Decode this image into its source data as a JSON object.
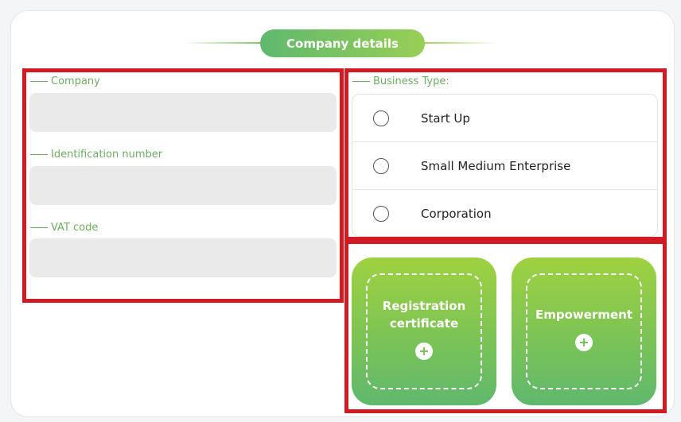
{
  "header": {
    "title": "Company details"
  },
  "form": {
    "fields": [
      {
        "label": "Company",
        "value": ""
      },
      {
        "label": "Identification number",
        "value": ""
      },
      {
        "label": "VAT code",
        "value": ""
      }
    ]
  },
  "business_type": {
    "legend": "Business Type:",
    "options": [
      {
        "label": "Start Up",
        "selected": false
      },
      {
        "label": "Small Medium Enterprise",
        "selected": false
      },
      {
        "label": "Corporation",
        "selected": false
      }
    ]
  },
  "uploads": [
    {
      "label": "Registration certificate",
      "icon": "plus-circle-icon"
    },
    {
      "label": "Empowerment",
      "icon": "plus-circle-icon"
    }
  ],
  "colors": {
    "accent_green": "#6cae60",
    "highlight_red": "#d01b25",
    "tile_gradient_top": "#9fd141",
    "tile_gradient_bottom": "#5fb86d"
  }
}
